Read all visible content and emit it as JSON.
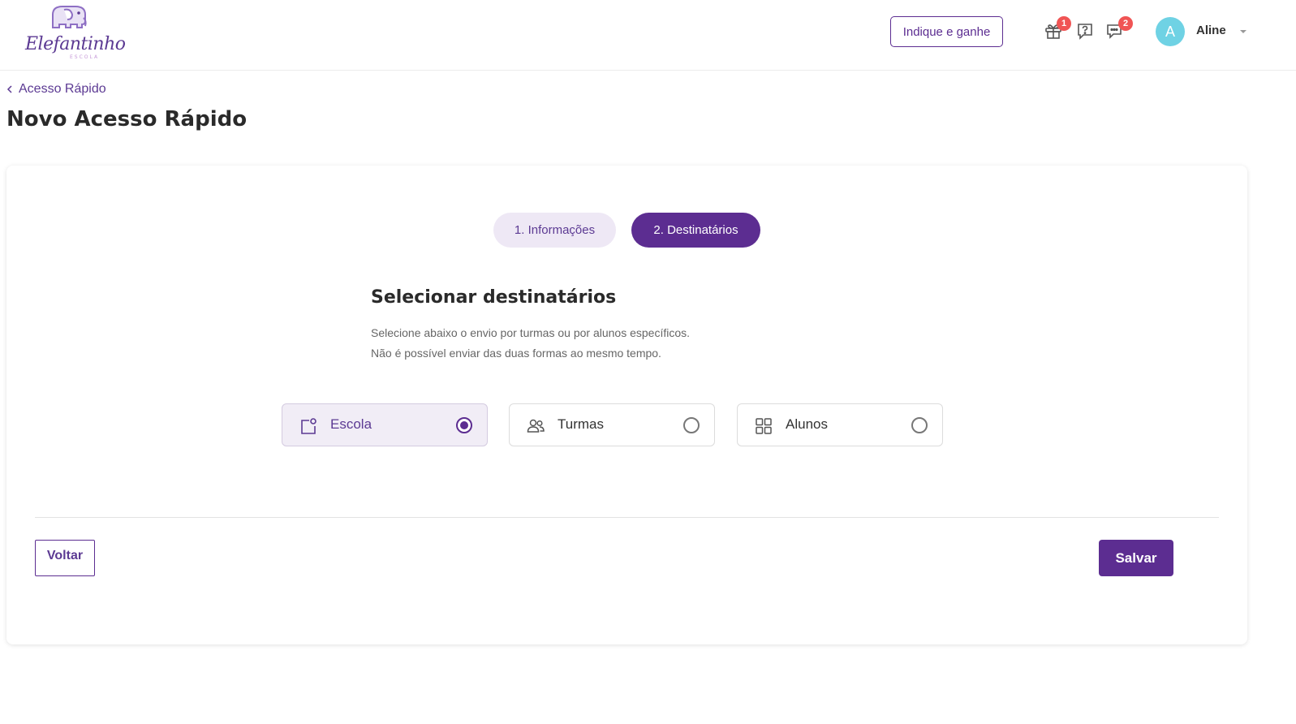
{
  "header": {
    "logo": {
      "text": "Elefantinho",
      "subtext": "ESCOLA",
      "icon": "elephant-logo-icon"
    },
    "indique_label": "Indique e ganhe",
    "icons": [
      {
        "name": "gift-icon",
        "badge": "1"
      },
      {
        "name": "help-icon",
        "badge": ""
      },
      {
        "name": "chat-icon",
        "badge": "2"
      }
    ],
    "user": {
      "initial": "A",
      "name": "Aline",
      "avatar_color": "#6fd2e4"
    }
  },
  "breadcrumb": {
    "label": "Acesso Rápido"
  },
  "page_title": "Novo Acesso Rápido",
  "steps": [
    {
      "label": "1. Informações",
      "active": false
    },
    {
      "label": "2. Destinatários",
      "active": true
    }
  ],
  "section": {
    "title": "Selecionar destinatários",
    "desc_line1": "Selecione abaixo o envio por turmas ou por alunos específicos.",
    "desc_line2": "Não é possível enviar das duas formas ao mesmo tempo."
  },
  "options": [
    {
      "label": "Escola",
      "icon": "school-icon",
      "selected": true
    },
    {
      "label": "Turmas",
      "icon": "users-icon",
      "selected": false
    },
    {
      "label": "Alunos",
      "icon": "grid-icon",
      "selected": false
    }
  ],
  "footer": {
    "back_label": "Voltar",
    "save_label": "Salvar"
  },
  "colors": {
    "primary": "#5c2d91",
    "selected_bg": "#f1edf6",
    "badge": "#f05454"
  }
}
